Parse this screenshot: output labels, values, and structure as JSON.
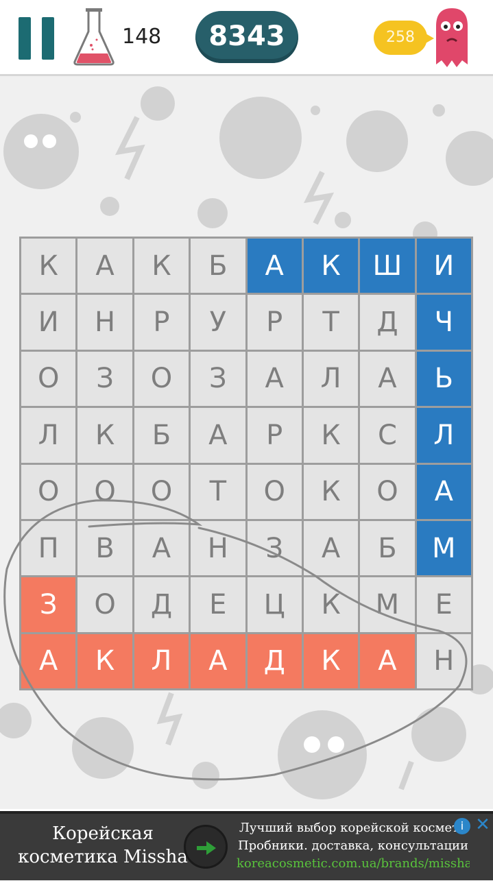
{
  "score": "8343",
  "flask_count": "148",
  "bubble_count": "258",
  "grid": [
    [
      "К",
      "А",
      "К",
      "Б",
      "А",
      "К",
      "Ш",
      "И"
    ],
    [
      "И",
      "Н",
      "Р",
      "У",
      "Р",
      "Т",
      "Д",
      "Ч"
    ],
    [
      "О",
      "З",
      "О",
      "З",
      "А",
      "Л",
      "А",
      "Ь"
    ],
    [
      "Л",
      "К",
      "Б",
      "А",
      "Р",
      "К",
      "С",
      "Л"
    ],
    [
      "О",
      "О",
      "О",
      "Т",
      "О",
      "К",
      "О",
      "А"
    ],
    [
      "П",
      "В",
      "А",
      "Н",
      "З",
      "А",
      "Б",
      "М"
    ],
    [
      "З",
      "О",
      "Д",
      "Е",
      "Ц",
      "К",
      "М",
      "Е"
    ],
    [
      "А",
      "К",
      "Л",
      "А",
      "Д",
      "К",
      "А",
      "Н"
    ]
  ],
  "highlight": [
    [
      "",
      "",
      "",
      "",
      "blue",
      "blue",
      "blue",
      "blue"
    ],
    [
      "",
      "",
      "",
      "",
      "",
      "",
      "",
      "blue"
    ],
    [
      "",
      "",
      "",
      "",
      "",
      "",
      "",
      "blue"
    ],
    [
      "",
      "",
      "",
      "",
      "",
      "",
      "",
      "blue"
    ],
    [
      "",
      "",
      "",
      "",
      "",
      "",
      "",
      "blue"
    ],
    [
      "",
      "",
      "",
      "",
      "",
      "",
      "",
      "blue"
    ],
    [
      "red",
      "",
      "",
      "",
      "",
      "",
      "",
      ""
    ],
    [
      "red",
      "red",
      "red",
      "red",
      "red",
      "red",
      "red",
      ""
    ]
  ],
  "colors": {
    "found_blue": "#2a7bc1",
    "found_red": "#f47a60",
    "score_bg": "#275f6a",
    "pause": "#1c6b72"
  },
  "ad": {
    "left_line1": "Корейская",
    "left_line2": "косметика Missha",
    "right_line1": "Лучший выбор корейской космети",
    "right_line2": "Пробники. доставка, консультации",
    "url": "koreacosmetic.com.ua/brands/missha",
    "info_icon": "i",
    "close_icon": "✕"
  },
  "icons": [
    "pause-icon",
    "flask-icon",
    "monster-icon",
    "arrow-icon",
    "info-icon",
    "close-icon"
  ]
}
